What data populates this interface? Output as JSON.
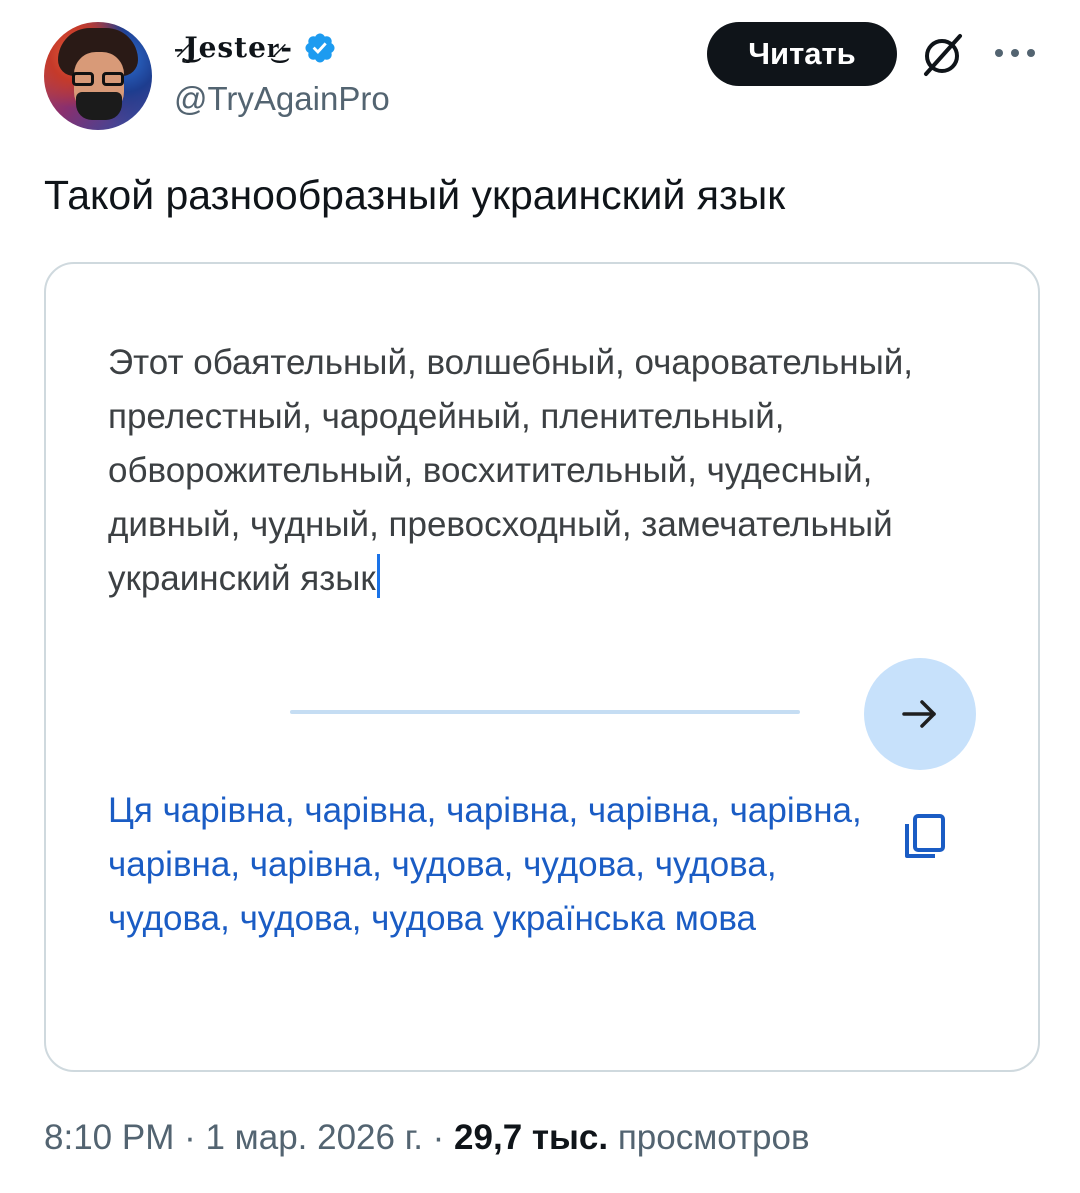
{
  "author": {
    "display_name": "-̷͜Jester̷͜-",
    "handle": "@TryAgainPro",
    "verified": true
  },
  "actions": {
    "follow_label": "Читать",
    "grok_icon": "slashed-circle-icon",
    "more_icon": "ellipsis-icon"
  },
  "tweet": {
    "text": "Такой разнообразный украинский язык"
  },
  "translator": {
    "source_text": "Этот обаятельный, волшебный, очаровательный, прелестный, чародейный, пленительный, обворожительный, восхитительный, чудесный, дивный, чудный, превосходный, замечательный украинский язык",
    "target_text": "Ця чарівна, чарівна, чарівна, чарівна, чарівна, чарівна, чарівна, чудова, чудова, чудова, чудова, чудова, чудова українська мова",
    "translate_icon": "arrow-right-icon",
    "copy_icon": "copy-icon"
  },
  "meta": {
    "time": "8:10 PM",
    "date": "1 мар. 2026 г.",
    "views_count": "29,7 тыс.",
    "views_label": "просмотров"
  },
  "colors": {
    "verified_blue": "#1d9bf0",
    "translation_blue": "#1a5cc4",
    "button_bg": "#c7e1fb"
  }
}
